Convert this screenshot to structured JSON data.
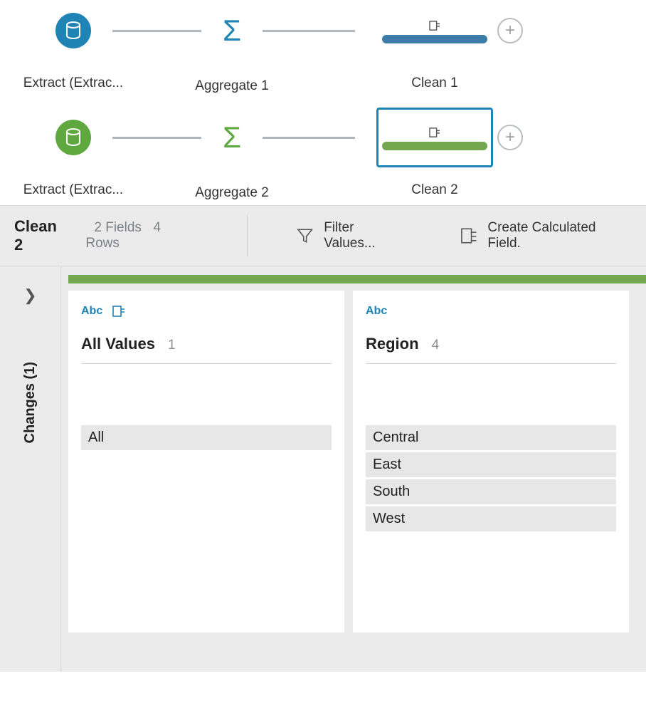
{
  "flow": {
    "rows": [
      {
        "color": "blue",
        "extract": {
          "label": "Extract (Extrac..."
        },
        "aggregate": {
          "label": "Aggregate 1"
        },
        "clean": {
          "label": "Clean 1",
          "selected": false
        }
      },
      {
        "color": "green",
        "extract": {
          "label": "Extract (Extrac..."
        },
        "aggregate": {
          "label": "Aggregate 2"
        },
        "clean": {
          "label": "Clean 2",
          "selected": true
        }
      }
    ]
  },
  "toolbar": {
    "title": "Clean 2",
    "fields_label": "2 Fields",
    "rows_label": "4 Rows",
    "filter_label": "Filter Values...",
    "calc_label": "Create Calculated Field."
  },
  "sidebar": {
    "changes_label": "Changes (1)"
  },
  "fields": [
    {
      "type_abbr": "Abc",
      "show_calc_icon": true,
      "name": "All Values",
      "count": "1",
      "values": [
        "All"
      ]
    },
    {
      "type_abbr": "Abc",
      "show_calc_icon": false,
      "name": "Region",
      "count": "4",
      "values": [
        "Central",
        "East",
        "South",
        "West"
      ]
    }
  ]
}
